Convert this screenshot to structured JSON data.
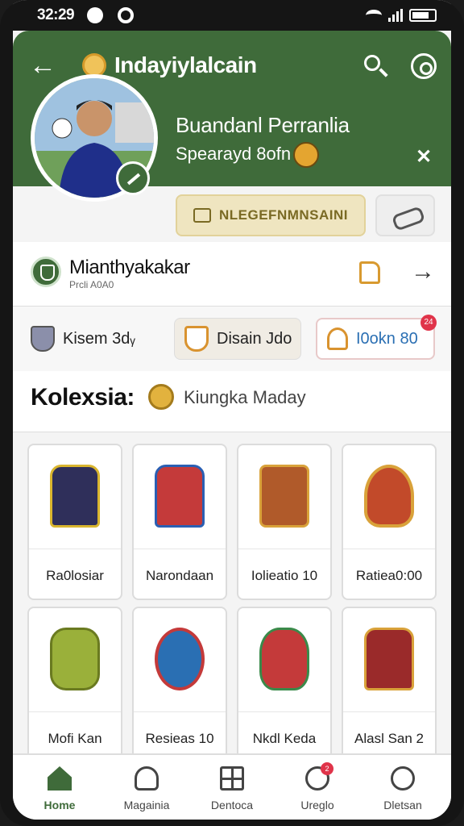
{
  "status": {
    "time": "32:29"
  },
  "header": {
    "title": "Indayiylalcain"
  },
  "profile": {
    "name": "Buandanl Perranlia",
    "subtitle": "Spearayd 8ofn",
    "follow_label": "NLEGEFNMNSAINI"
  },
  "section": {
    "title": "Mianthyakakar",
    "subtitle": "Prcli A0A0"
  },
  "chips": [
    {
      "label": "Kisem 3dᵧ"
    },
    {
      "label": "Disain Jdo"
    },
    {
      "label": "I0okn 80",
      "badge": "24"
    }
  ],
  "collection": {
    "title": "Kolexsia:",
    "subtitle": "Kiungka Maday"
  },
  "items": [
    {
      "label": "Ra0losiar",
      "color": "#2f2f5a",
      "accent": "#d9b52e"
    },
    {
      "label": "Narondaan",
      "color": "#c43a3a",
      "accent": "#2a5fb3"
    },
    {
      "label": "Iolieatio 10",
      "color": "#b05a2a",
      "accent": "#d9a23a"
    },
    {
      "label": "Ratiea0:00",
      "color": "#c24a2a",
      "accent": "#2a5fb3"
    },
    {
      "label": "Mofi Kan",
      "color": "#9ab03a",
      "accent": "#6a7a20"
    },
    {
      "label": "Resieas 10",
      "color": "#2a6fb3",
      "accent": "#c43a3a"
    },
    {
      "label": "Nkdl Keda",
      "color": "#c43a3a",
      "accent": "#3a8a4a"
    },
    {
      "label": "Alasl San 2",
      "color": "#9a2a2a",
      "accent": "#d9a23a"
    }
  ],
  "nav": [
    {
      "label": "Home",
      "icon": "home-icon"
    },
    {
      "label": "Magainia",
      "icon": "user-icon"
    },
    {
      "label": "Dentoca",
      "icon": "grid-icon"
    },
    {
      "label": "Ureglo",
      "icon": "heart-icon",
      "badge": "2"
    },
    {
      "label": "Dletsan",
      "icon": "profile-icon"
    }
  ]
}
